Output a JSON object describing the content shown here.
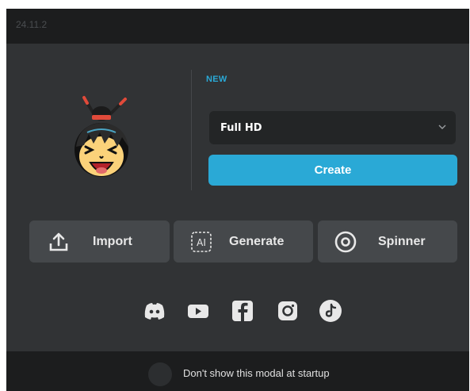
{
  "app": {
    "version": "24.11.2"
  },
  "new_section": {
    "label": "NEW",
    "resolution_select": {
      "value": "Full HD"
    },
    "create_label": "Create"
  },
  "actions": [
    {
      "label": "Import",
      "icon": "upload-icon"
    },
    {
      "label": "Generate",
      "icon": "ai-icon"
    },
    {
      "label": "Spinner",
      "icon": "spinner-icon"
    }
  ],
  "social": [
    {
      "icon": "discord-icon"
    },
    {
      "icon": "youtube-icon"
    },
    {
      "icon": "facebook-icon"
    },
    {
      "icon": "instagram-icon"
    },
    {
      "icon": "tiktok-icon"
    }
  ],
  "footer": {
    "startup_text": "Don't show this modal at startup"
  },
  "colors": {
    "accent": "#2aa9d6",
    "modal_bg": "#313335",
    "header_bg": "#1c1d1e",
    "button_bg": "#45484b",
    "select_bg": "#232526"
  }
}
